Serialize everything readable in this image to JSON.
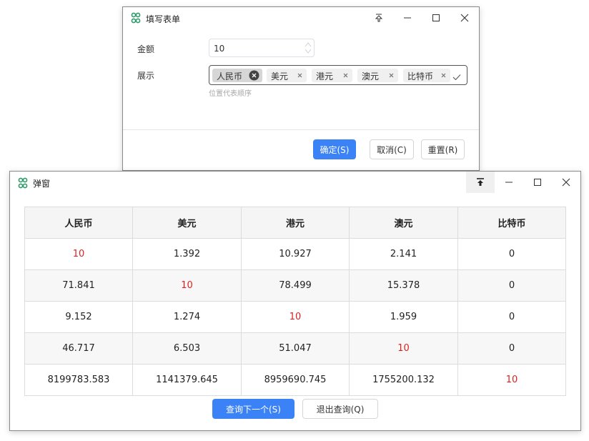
{
  "form_window": {
    "title": "填写表单",
    "amount_label": "金额",
    "amount_value": "10",
    "display_label": "展示",
    "tags": [
      "人民币",
      "美元",
      "港元",
      "澳元",
      "比特币"
    ],
    "hint": "位置代表顺序",
    "confirm_button": "确定(S)",
    "cancel_button": "取消(C)",
    "reset_button": "重置(R)"
  },
  "popup_window": {
    "title": "弹窗",
    "table": {
      "headers": [
        "人民币",
        "美元",
        "港元",
        "澳元",
        "比特币"
      ],
      "rows": [
        [
          "10",
          "1.392",
          "10.927",
          "2.141",
          "0"
        ],
        [
          "71.841",
          "10",
          "78.499",
          "15.378",
          "0"
        ],
        [
          "9.152",
          "1.274",
          "10",
          "1.959",
          "0"
        ],
        [
          "46.717",
          "6.503",
          "51.047",
          "10",
          "0"
        ],
        [
          "8199783.583",
          "1141379.645",
          "8959690.745",
          "1755200.132",
          "10"
        ]
      ]
    },
    "next_button": "查询下一个(S)",
    "exit_button": "退出查询(Q)"
  },
  "colors": {
    "accent": "#3b82f6",
    "highlight": "#e02020",
    "logo": "#2e9a6a"
  }
}
